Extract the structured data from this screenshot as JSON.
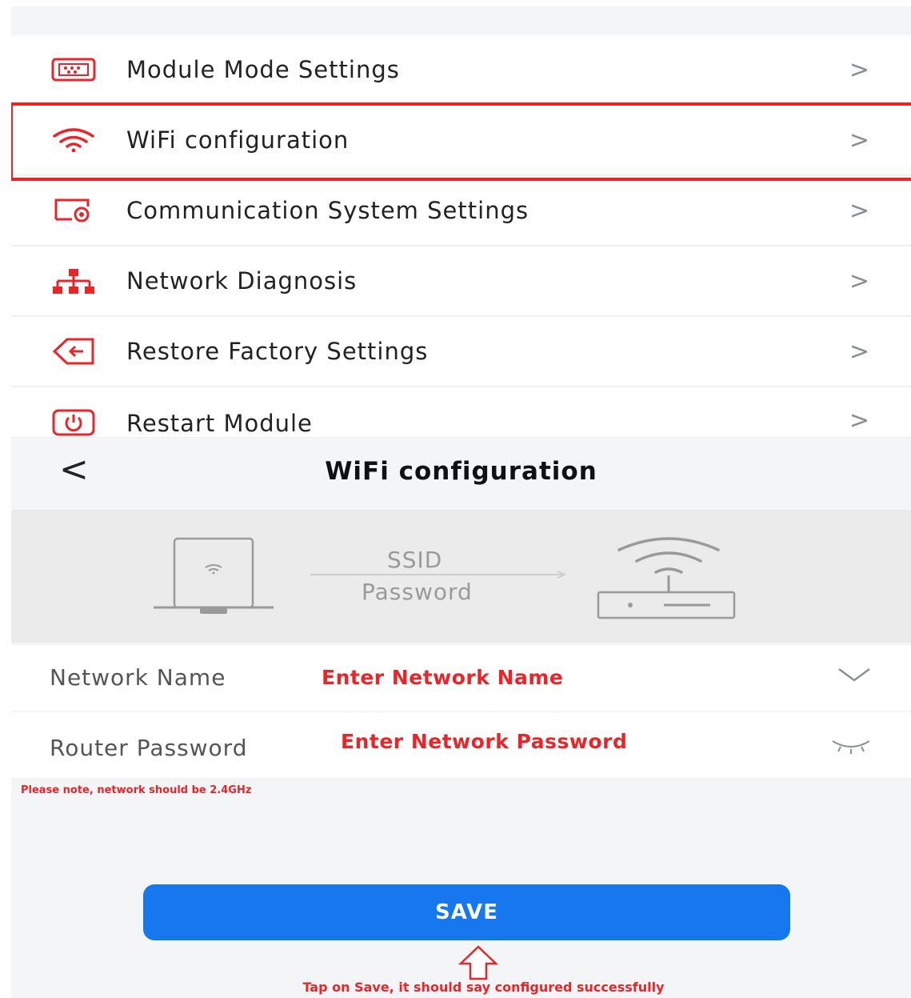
{
  "menu": {
    "items": [
      {
        "label": "Module Mode Settings",
        "icon": "module-icon"
      },
      {
        "label": "WiFi configuration",
        "icon": "wifi-icon"
      },
      {
        "label": "Communication System Settings",
        "icon": "communication-settings-icon"
      },
      {
        "label": "Network Diagnosis",
        "icon": "network-tree-icon"
      },
      {
        "label": "Restore Factory Settings",
        "icon": "restore-icon"
      },
      {
        "label": "Restart Module",
        "icon": "power-icon"
      }
    ],
    "chevron": ">"
  },
  "header": {
    "back_glyph": "<",
    "title": "WiFi configuration"
  },
  "illustration": {
    "ssid": "SSID",
    "password": "Password"
  },
  "form": {
    "network_name_label": "Network Name",
    "network_name_placeholder": "Enter Network Name",
    "router_password_label": "Router Password",
    "router_password_placeholder": "Enter Network Password"
  },
  "note": "Please note, network should be 2.4GHz",
  "save_label": "SAVE",
  "tap_instruction": "Tap on Save, it should say configured successfully",
  "colors": {
    "accent_red": "#e8262a",
    "button_blue": "#1677ee"
  }
}
